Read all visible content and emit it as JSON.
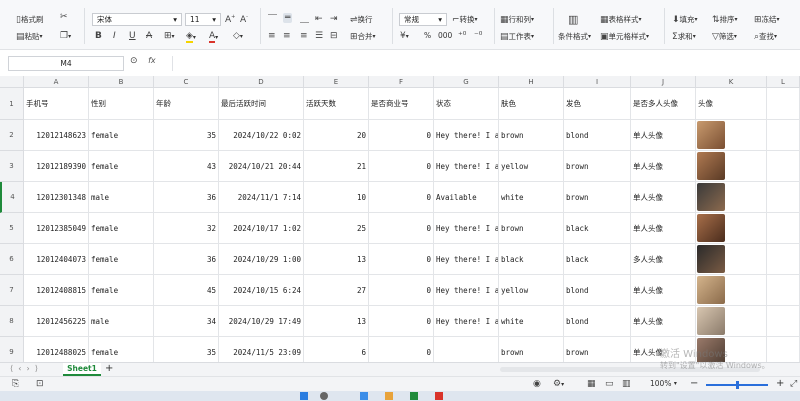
{
  "ribbon": {
    "format_painter": "格式刷",
    "paste": "粘贴",
    "font_name": "宋体",
    "font_size": "11",
    "wrap_text": "换行",
    "merge": "合并",
    "number_format": "常规",
    "convert": "转换",
    "rows_cols": "行和列",
    "worksheet": "工作表",
    "cond_format": "条件格式",
    "table_style": "表格样式",
    "cell_style": "单元格样式",
    "fill": "填充",
    "sort": "排序",
    "freeze": "冻结",
    "sum": "求和",
    "filter": "筛选",
    "find": "查找",
    "percent": "%",
    "thousands": "000"
  },
  "formula_bar": {
    "cell_ref": "M4",
    "fx": "fx"
  },
  "columns": [
    "A",
    "B",
    "C",
    "D",
    "E",
    "F",
    "G",
    "H",
    "I",
    "J",
    "K",
    "L"
  ],
  "headers": [
    "手机号",
    "性别",
    "年龄",
    "最后活跃时间",
    "活跃天数",
    "是否商业号",
    "状态",
    "肤色",
    "发色",
    "是否多人头像",
    "头像"
  ],
  "rows": [
    {
      "num": "2",
      "phone": "12012148623",
      "gender": "female",
      "age": "35",
      "last_active": "2024/10/22 0:02",
      "days": "20",
      "business": "0",
      "status": "Hey there! I a",
      "skin": "brown",
      "hair": "blond",
      "multi": "单人头像"
    },
    {
      "num": "3",
      "phone": "12012189390",
      "gender": "female",
      "age": "43",
      "last_active": "2024/10/21 20:44",
      "days": "21",
      "business": "0",
      "status": "Hey there! I a",
      "skin": "yellow",
      "hair": "brown",
      "multi": "单人头像"
    },
    {
      "num": "4",
      "phone": "12012301348",
      "gender": "male",
      "age": "36",
      "last_active": "2024/11/1 7:14",
      "days": "10",
      "business": "0",
      "status": "Available",
      "skin": "white",
      "hair": "brown",
      "multi": "单人头像"
    },
    {
      "num": "5",
      "phone": "12012385049",
      "gender": "female",
      "age": "32",
      "last_active": "2024/10/17 1:02",
      "days": "25",
      "business": "0",
      "status": "Hey there! I a",
      "skin": "brown",
      "hair": "black",
      "multi": "单人头像"
    },
    {
      "num": "6",
      "phone": "12012404073",
      "gender": "female",
      "age": "36",
      "last_active": "2024/10/29 1:00",
      "days": "13",
      "business": "0",
      "status": "Hey there! I a",
      "skin": "black",
      "hair": "black",
      "multi": "多人头像"
    },
    {
      "num": "7",
      "phone": "12012408815",
      "gender": "female",
      "age": "45",
      "last_active": "2024/10/15 6:24",
      "days": "27",
      "business": "0",
      "status": "Hey there! I a",
      "skin": "yellow",
      "hair": "blond",
      "multi": "单人头像"
    },
    {
      "num": "8",
      "phone": "12012456225",
      "gender": "male",
      "age": "34",
      "last_active": "2024/10/29 17:49",
      "days": "13",
      "business": "0",
      "status": "Hey there! I a",
      "skin": "white",
      "hair": "blond",
      "multi": "单人头像"
    },
    {
      "num": "9",
      "phone": "12012488025",
      "gender": "female",
      "age": "35",
      "last_active": "2024/11/5 23:09",
      "days": "6",
      "business": "0",
      "status": "",
      "skin": "brown",
      "hair": "brown",
      "multi": "单人头像"
    }
  ],
  "sheet_tab": "Sheet1",
  "zoom": "100%",
  "watermark": {
    "line1": "激活 Windows",
    "line2": "转到\"设置\"以激活 Windows。"
  },
  "colors": {
    "accent": "#1f8a3b",
    "ribbon_bg": "#f7f8fa",
    "font_color_red": "#d9342b",
    "highlight_yellow": "#f5d400"
  }
}
